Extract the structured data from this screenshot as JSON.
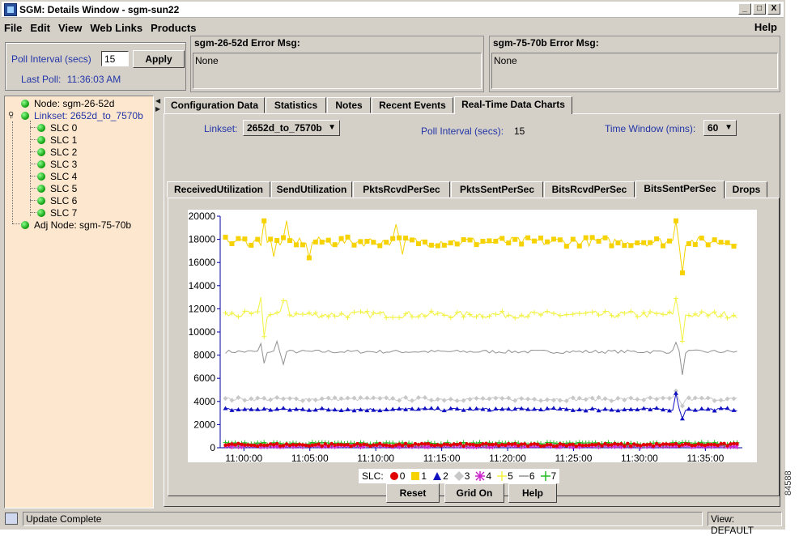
{
  "window": {
    "title": "SGM: Details Window - sgm-sun22",
    "controls": [
      "_",
      "□",
      "X"
    ]
  },
  "menu": {
    "items": [
      "File",
      "Edit",
      "View",
      "Web Links",
      "Products"
    ],
    "help": "Help"
  },
  "poll": {
    "label": "Poll Interval (secs)",
    "value": "15",
    "apply": "Apply",
    "last_poll_label": "Last Poll:",
    "last_poll_time": "11:36:03 AM"
  },
  "errors": [
    {
      "title": "sgm-26-52d  Error Msg:",
      "message": "None"
    },
    {
      "title": "sgm-75-70b  Error Msg:",
      "message": "None"
    }
  ],
  "tree": {
    "node": "Node: sgm-26-52d",
    "linkset": "Linkset: 2652d_to_7570b",
    "slcs": [
      "SLC 0",
      "SLC 1",
      "SLC 2",
      "SLC 3",
      "SLC 4",
      "SLC 5",
      "SLC 6",
      "SLC 7"
    ],
    "adj_node": "Adj Node: sgm-75-70b"
  },
  "main_tabs": [
    "Configuration Data",
    "Statistics",
    "Notes",
    "Recent Events",
    "Real-Time Data Charts"
  ],
  "active_main_tab": "Real-Time Data Charts",
  "controls": {
    "linkset_label": "Linkset:",
    "linkset_value": "2652d_to_7570b",
    "poll_label": "Poll Interval (secs):",
    "poll_value": "15",
    "window_label": "Time Window (mins):",
    "window_value": "60"
  },
  "chart_tabs": [
    "ReceivedUtilization",
    "SendUtilization",
    "PktsRcvdPerSec",
    "PktsSentPerSec",
    "BitsRcvdPerSec",
    "BitsSentPerSec",
    "Drops"
  ],
  "active_chart_tab": "BitsSentPerSec",
  "chart_data": {
    "type": "line",
    "title": "",
    "xlabel": "",
    "ylabel": "",
    "x_ticks": [
      "11:00:00",
      "11:05:00",
      "11:10:00",
      "11:15:00",
      "11:20:00",
      "11:25:00",
      "11:30:00",
      "11:35:00"
    ],
    "y_ticks": [
      0,
      2000,
      4000,
      6000,
      8000,
      10000,
      12000,
      14000,
      16000,
      18000,
      20000
    ],
    "ylim": [
      0,
      20000
    ],
    "xlim_minutes": [
      58.2,
      97.8
    ],
    "legend_title": "SLC:",
    "series": [
      {
        "name": "0",
        "color": "#e00000",
        "marker": "circle",
        "base": 250,
        "noise": 120
      },
      {
        "name": "1",
        "color": "#f5d200",
        "marker": "square",
        "base": 17800,
        "noise": 400,
        "spikes": [
          [
            61.5,
            19600
          ],
          [
            62.2,
            16500
          ],
          [
            63.3,
            19600
          ],
          [
            65.0,
            16400
          ],
          [
            71.5,
            19300
          ],
          [
            72.0,
            16700
          ],
          [
            92.8,
            19600
          ],
          [
            93.2,
            15100
          ]
        ]
      },
      {
        "name": "2",
        "color": "#1010c0",
        "marker": "triangle",
        "base": 3300,
        "noise": 120,
        "spikes": [
          [
            92.8,
            4700
          ],
          [
            93.2,
            2500
          ]
        ]
      },
      {
        "name": "3",
        "color": "#c8c8c8",
        "marker": "diamond",
        "base": 4200,
        "noise": 150,
        "spikes": [
          [
            92.8,
            4900
          ],
          [
            93.2,
            3600
          ]
        ]
      },
      {
        "name": "4",
        "color": "#cc22cc",
        "marker": "star",
        "base": 150,
        "noise": 80
      },
      {
        "name": "5",
        "color": "#f2f240",
        "marker": "plus",
        "base": 11500,
        "noise": 300,
        "spikes": [
          [
            61.2,
            13000
          ],
          [
            61.6,
            9600
          ],
          [
            63.1,
            12700
          ],
          [
            92.8,
            12900
          ],
          [
            93.2,
            9200
          ]
        ]
      },
      {
        "name": "6",
        "color": "#909090",
        "marker": "dash",
        "base": 8300,
        "noise": 150,
        "spikes": [
          [
            61.2,
            9000
          ],
          [
            61.6,
            7300
          ],
          [
            62.5,
            9200
          ],
          [
            63.0,
            7200
          ],
          [
            92.8,
            9100
          ],
          [
            93.2,
            6300
          ]
        ]
      },
      {
        "name": "7",
        "color": "#22bb22",
        "marker": "plus",
        "base": 350,
        "noise": 120
      }
    ]
  },
  "buttons": {
    "reset": "Reset",
    "grid": "Grid On",
    "help": "Help"
  },
  "status": {
    "text": "Update Complete",
    "view": "View: DEFAULT"
  },
  "figure_number": "84588"
}
